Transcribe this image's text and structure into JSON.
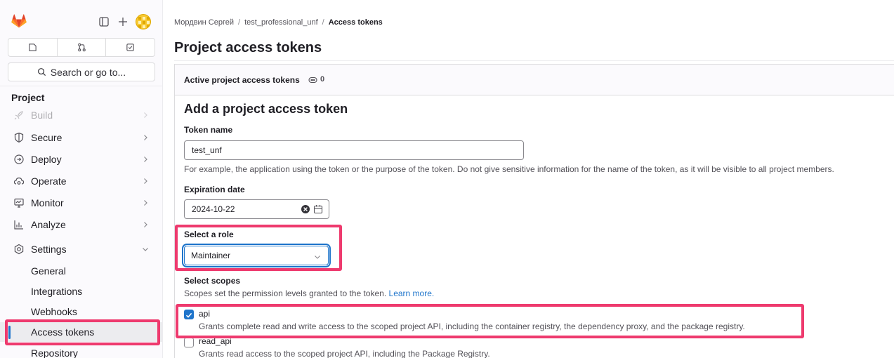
{
  "sidebar": {
    "tabs": [
      {
        "name": "issues-icon"
      },
      {
        "name": "merge-request-icon"
      },
      {
        "name": "todo-icon"
      }
    ],
    "search_label": "Search or go to...",
    "section_title": "Project",
    "nav_items": [
      {
        "label": "Build",
        "icon": "rocket-icon"
      },
      {
        "label": "Secure",
        "icon": "shield-icon"
      },
      {
        "label": "Deploy",
        "icon": "deploy-icon"
      },
      {
        "label": "Operate",
        "icon": "cloud-icon"
      },
      {
        "label": "Monitor",
        "icon": "monitor-icon"
      },
      {
        "label": "Analyze",
        "icon": "chart-icon"
      },
      {
        "label": "Settings",
        "icon": "settings-icon"
      }
    ],
    "settings_sub_items": [
      {
        "label": "General"
      },
      {
        "label": "Integrations"
      },
      {
        "label": "Webhooks"
      },
      {
        "label": "Access tokens",
        "active": true
      },
      {
        "label": "Repository"
      }
    ]
  },
  "breadcrumb": {
    "items": [
      "Мордвин Сергей",
      "test_professional_unf",
      "Access tokens"
    ],
    "separator": "/"
  },
  "page": {
    "title": "Project access tokens",
    "active_tokens_label": "Active project access tokens",
    "active_tokens_count": "0"
  },
  "form": {
    "heading": "Add a project access token",
    "token_name_label": "Token name",
    "token_name_value": "test_unf",
    "token_name_help": "For example, the application using the token or the purpose of the token. Do not give sensitive information for the name of the token, as it will be visible to all project members.",
    "expiration_label": "Expiration date",
    "expiration_value": "2024-10-22",
    "role_label": "Select a role",
    "role_value": "Maintainer",
    "scopes_label": "Select scopes",
    "scopes_help": "Scopes set the permission levels granted to the token.",
    "scopes_help_link": "Learn more.",
    "scopes": [
      {
        "name": "api",
        "checked": true,
        "description": "Grants complete read and write access to the scoped project API, including the container registry, the dependency proxy, and the package registry."
      },
      {
        "name": "read_api",
        "checked": false,
        "description": "Grants read access to the scoped project API, including the Package Registry."
      }
    ]
  },
  "colors": {
    "accent": "#1f75cb",
    "highlight": "#ee3a6e",
    "brand": "#fc6d26"
  }
}
